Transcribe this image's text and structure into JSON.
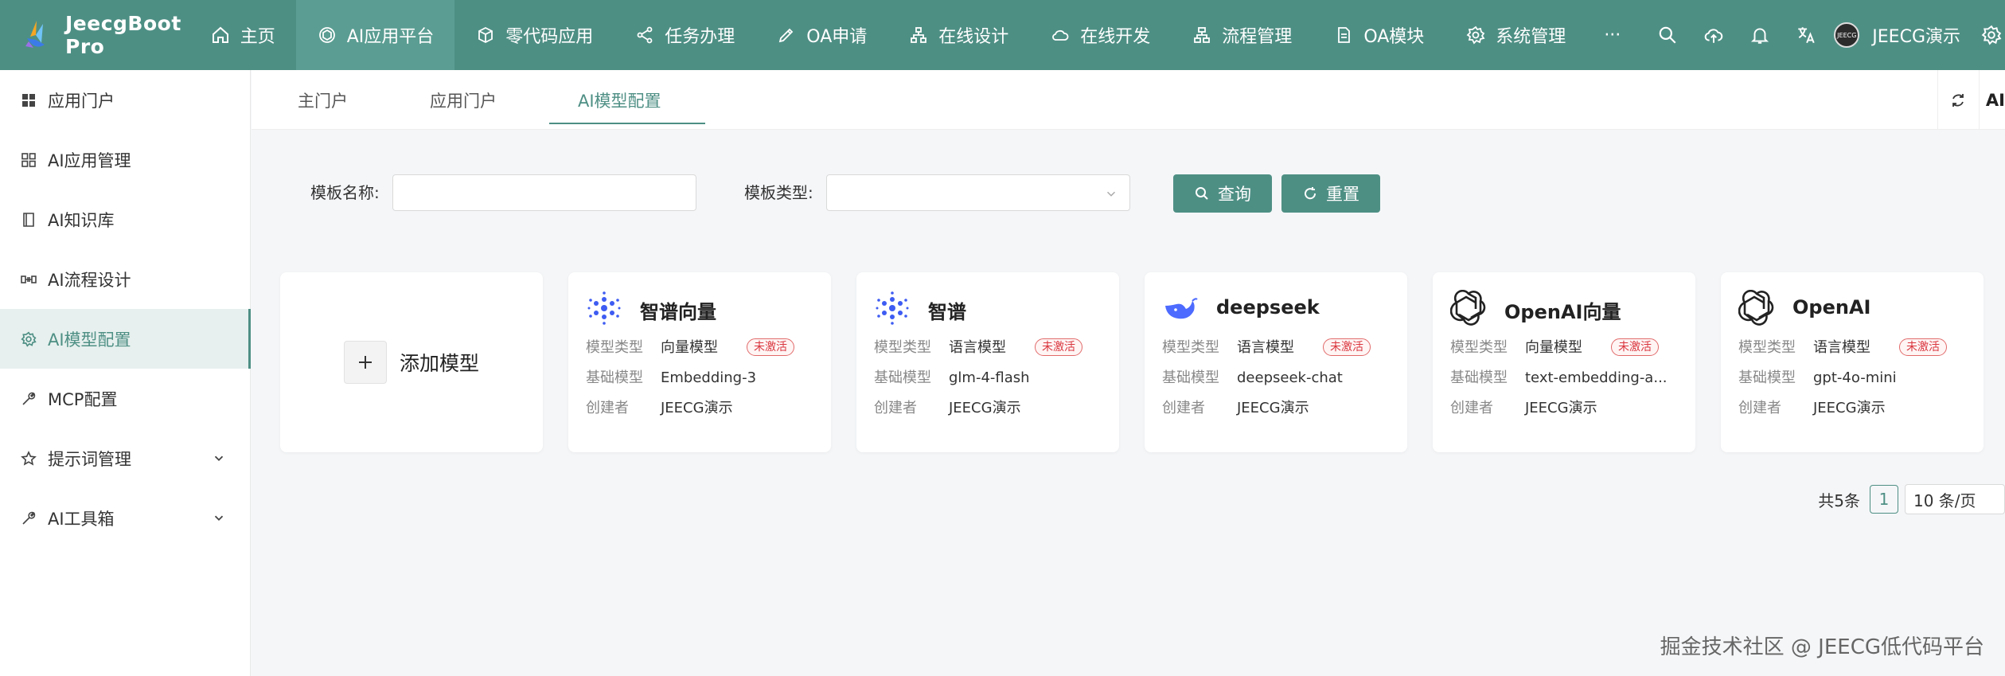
{
  "app": {
    "title": "JeecgBoot Pro"
  },
  "header": {
    "nav": [
      {
        "label": "主页",
        "icon": "home-icon"
      },
      {
        "label": "AI应用平台",
        "icon": "openai-icon",
        "active": true
      },
      {
        "label": "零代码应用",
        "icon": "box-icon"
      },
      {
        "label": "任务办理",
        "icon": "share-icon"
      },
      {
        "label": "OA申请",
        "icon": "pen-icon"
      },
      {
        "label": "在线设计",
        "icon": "sitemap-icon"
      },
      {
        "label": "在线开发",
        "icon": "cloud-icon"
      },
      {
        "label": "流程管理",
        "icon": "flow-icon"
      },
      {
        "label": "OA模块",
        "icon": "document-icon"
      },
      {
        "label": "系统管理",
        "icon": "gear-icon"
      }
    ],
    "more": "···",
    "user_name": "JEECG演示",
    "avatar_text": "JEECG"
  },
  "sidebar": {
    "items": [
      {
        "label": "应用门户",
        "icon": "grid-solid-icon"
      },
      {
        "label": "AI应用管理",
        "icon": "grid-icon"
      },
      {
        "label": "AI知识库",
        "icon": "book-icon"
      },
      {
        "label": "AI流程设计",
        "icon": "flow-design-icon"
      },
      {
        "label": "AI模型配置",
        "icon": "gear-icon",
        "active": true
      },
      {
        "label": "MCP配置",
        "icon": "wrench-icon"
      },
      {
        "label": "提示词管理",
        "icon": "star-icon",
        "expandable": true
      },
      {
        "label": "AI工具箱",
        "icon": "tool-icon",
        "expandable": true
      }
    ]
  },
  "tabs": [
    {
      "label": "主门户"
    },
    {
      "label": "应用门户"
    },
    {
      "label": "AI模型配置",
      "active": true
    }
  ],
  "tab_tools_label": "AI",
  "search": {
    "name_label": "模板名称:",
    "name_value": "",
    "type_label": "模板类型:",
    "type_value": "",
    "query_button": "查询",
    "reset_button": "重置"
  },
  "add_card": {
    "label": "添加模型"
  },
  "field_keys": {
    "type": "模型类型",
    "base": "基础模型",
    "creator": "创建者"
  },
  "models": [
    {
      "title": "智谱向量",
      "logo": "zhipu-logo-icon",
      "type": "向量模型",
      "base": "Embedding-3",
      "creator": "JEECG演示",
      "status": "未激活"
    },
    {
      "title": "智谱",
      "logo": "zhipu-logo-icon",
      "type": "语言模型",
      "base": "glm-4-flash",
      "creator": "JEECG演示",
      "status": "未激活"
    },
    {
      "title": "deepseek",
      "logo": "deepseek-logo-icon",
      "type": "语言模型",
      "base": "deepseek-chat",
      "creator": "JEECG演示",
      "status": "未激活"
    },
    {
      "title": "OpenAI向量",
      "logo": "openai-logo-icon",
      "type": "向量模型",
      "base": "text-embedding-a...",
      "creator": "JEECG演示",
      "status": "未激活"
    },
    {
      "title": "OpenAI",
      "logo": "openai-logo-icon",
      "type": "语言模型",
      "base": "gpt-4o-mini",
      "creator": "JEECG演示",
      "status": "未激活"
    }
  ],
  "pager": {
    "total": "共5条",
    "page": "1",
    "size": "10 条/页"
  },
  "watermark": "掘金技术社区 @ JEECG低代码平台",
  "colors": {
    "primary": "#4e8f84",
    "header": "#4e8f84",
    "tag_red": "#d9363e"
  }
}
